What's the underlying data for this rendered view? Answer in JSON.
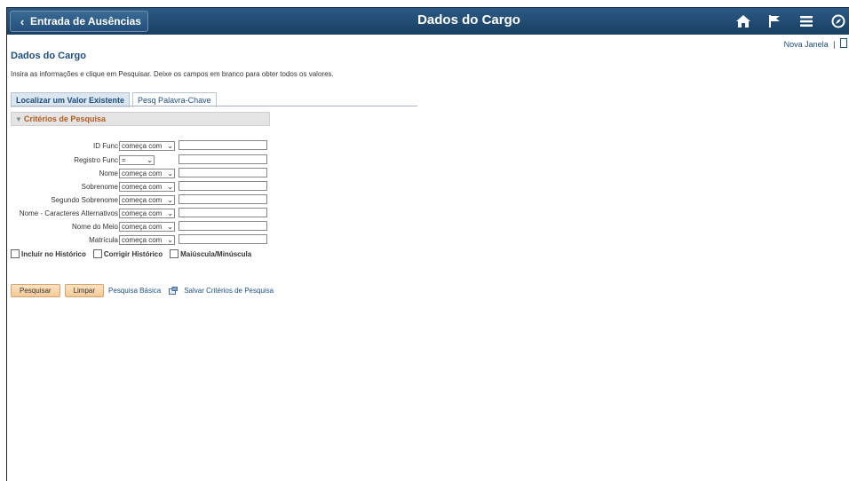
{
  "header": {
    "back_label": "Entrada de Ausências",
    "title": "Dados do Cargo",
    "icons": [
      "home-icon",
      "flag-icon",
      "menu-icon",
      "compass-icon"
    ]
  },
  "top_links": {
    "new_window": "Nova Janela",
    "separator": "|"
  },
  "page": {
    "title": "Dados do Cargo",
    "instructions": "Insira as informações e clique em Pesquisar. Deixe os campos em branco para obter todos os valores."
  },
  "tabs": [
    {
      "label": "Localizar um Valor Existente",
      "active": true
    },
    {
      "label": "Pesq Palavra-Chave",
      "active": false
    }
  ],
  "criteria": {
    "title": "Critérios de Pesquisa",
    "fields": [
      {
        "label": "ID Func",
        "operator": "começa com",
        "value": ""
      },
      {
        "label": "Registro Func",
        "operator": "=",
        "value": ""
      },
      {
        "label": "Nome",
        "operator": "começa com",
        "value": ""
      },
      {
        "label": "Sobrenome",
        "operator": "começa com",
        "value": ""
      },
      {
        "label": "Segundo Sobrenome",
        "operator": "começa com",
        "value": ""
      },
      {
        "label": "Nome - Caracteres Alternativos",
        "operator": "começa com",
        "value": ""
      },
      {
        "label": "Nome do Meio",
        "operator": "começa com",
        "value": ""
      },
      {
        "label": "Matrícula",
        "operator": "começa com",
        "value": ""
      }
    ],
    "checkboxes": [
      {
        "label": "Incluir no Histórico",
        "checked": false
      },
      {
        "label": "Corrigir Histórico",
        "checked": false
      },
      {
        "label": "Maiúscula/Minúscula",
        "checked": false
      }
    ]
  },
  "actions": {
    "search": "Pesquisar",
    "clear": "Limpar",
    "basic_search": "Pesquisa Básica",
    "save_criteria": "Salvar Critérios de Pesquisa"
  },
  "colors": {
    "banner": "#1f4a72",
    "link": "#1c4e80",
    "section_title": "#b35c1e",
    "button": "#f5c996"
  }
}
